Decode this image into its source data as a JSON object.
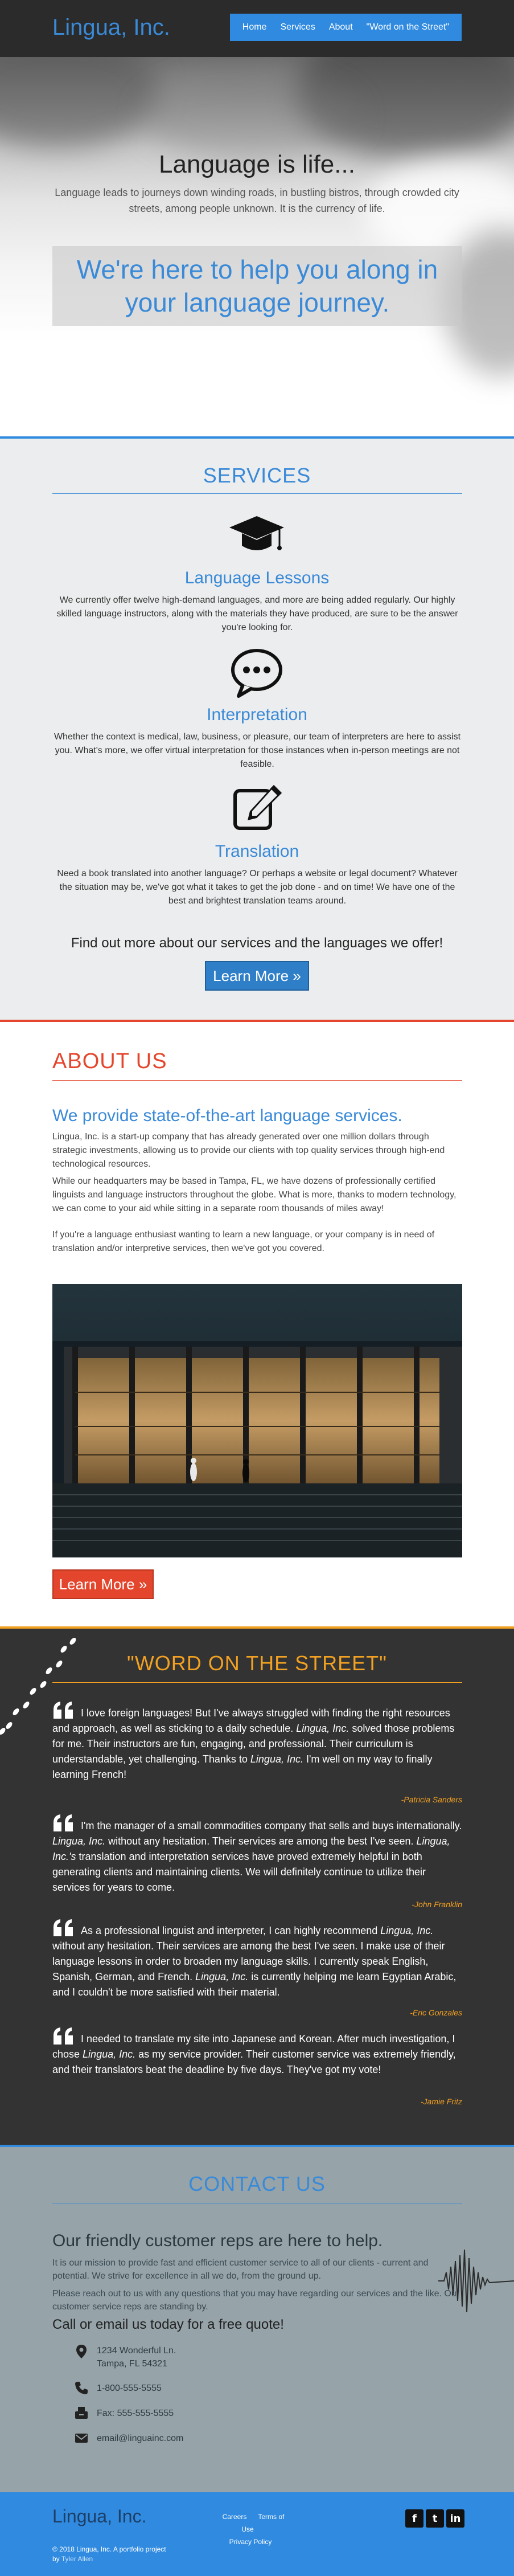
{
  "header": {
    "logo": "Lingua, Inc.",
    "nav": [
      {
        "label": "Home"
      },
      {
        "label": "Services"
      },
      {
        "label": "About"
      },
      {
        "label": "\"Word on the Street\""
      }
    ]
  },
  "hero": {
    "title": "Language is life...",
    "subtitle": "Language leads to journeys down winding roads, in bustling bistros, through crowded city streets, among people unknown. It is the currency of life.",
    "tagline": "We're here to help you along in your language journey."
  },
  "services": {
    "heading": "SERVICES",
    "items": [
      {
        "icon": "graduation-cap-icon",
        "title": "Language Lessons",
        "text": "We currently offer twelve high-demand languages, and more are being added regularly. Our highly skilled language instructors, along with the materials they have produced, are sure to be the answer you're looking for."
      },
      {
        "icon": "speech-bubble-icon",
        "title": "Interpretation",
        "text": "Whether the context is medical, law, business, or pleasure, our team of interpreters are here to assist you. What's more, we offer virtual interpretation for those instances when in-person meetings are not feasible."
      },
      {
        "icon": "edit-icon",
        "title": "Translation",
        "text": "Need a book translated into another language? Or perhaps a website or legal document? Whatever the situation may be, we've got what it takes to get the job done - and on time! We have one of the best and brightest translation teams around."
      }
    ],
    "cta_text": "Find out more about our services and the languages we offer!",
    "cta_button": "Learn More »"
  },
  "about": {
    "heading": "ABOUT US",
    "lead": "We provide state-of-the-art language services.",
    "paragraphs": [
      "Lingua, Inc. is a start-up company that has already generated over one million dollars through strategic investments, allowing us to provide our clients with top quality services through high-end technological resources.",
      "While our headquarters may be based in Tampa, FL, we have dozens of professionally certified linguists and language instructors throughout the globe. What is more, thanks to modern technology, we can come to your aid while sitting in a separate room thousands of miles away!",
      "If you're a language enthusiast wanting to learn a new language, or your company is in need of translation and/or interpretive services, then we've got you covered."
    ],
    "button": "Learn More »"
  },
  "street": {
    "heading": "\"WORD ON THE STREET\"",
    "quotes": [
      {
        "parts": [
          "I love foreign languages! But I've always struggled with finding the right resources and approach, as well as sticking to a daily schedule. ",
          "Lingua, Inc.",
          " solved those problems for me. Their instructors are fun, engaging, and professional. Their curriculum is understandable, yet challenging. Thanks to ",
          "Lingua, Inc.",
          " I'm well on my way to finally learning French!"
        ],
        "author": "-Patricia Sanders"
      },
      {
        "parts": [
          "I'm the manager of a small commodities company that sells and buys internationally. ",
          "Lingua, Inc.",
          " without any hesitation. Their services are among the best I've seen. ",
          "Lingua, Inc.'s",
          " translation and interpretation services have proved extremely helpful in both generating clients and maintaining clients. We will definitely continue to utilize their services for years to come."
        ],
        "author": "-John Franklin"
      },
      {
        "parts": [
          "As a professional linguist and interpreter, I can highly recommend ",
          "Lingua, Inc.",
          " without any hesitation. Their services are among the best I've seen. I make use of their language lessons in order to broaden my language skills. I currently speak English, Spanish, German, and French. ",
          "Lingua, Inc.",
          " is currently helping me learn Egyptian Arabic, and I couldn't be more satisfied with their material."
        ],
        "author": "-Eric Gonzales"
      },
      {
        "parts": [
          "I needed to translate my site into Japanese and Korean. After much investigation, I chose ",
          "Lingua, Inc.",
          " as my service provider. Their customer service was extremely friendly, and their translators beat the deadline by five days. They've got my vote!"
        ],
        "author": "-Jamie Fritz"
      }
    ]
  },
  "contact": {
    "heading": "CONTACT US",
    "lead": "Our friendly customer reps are here to help.",
    "paragraphs": [
      "It is our mission to provide fast and efficient customer service to all of our clients - current and potential. We strive for excellence in all we do, from the ground up.",
      "Please reach out to us with any questions that you may have regarding our services and the like. Our customer service reps are standing by."
    ],
    "call_text": "Call or email us today for a free quote!",
    "address_line1": "1234 Wonderful Ln.",
    "address_line2": "Tampa, FL 54321",
    "phone": "1-800-555-5555",
    "fax": "Fax: 555-555-5555",
    "email": "email@linguainc.com"
  },
  "footer": {
    "logo": "Lingua, Inc.",
    "copyright": "© 2018 Lingua, Inc.  A portfolio project",
    "credit_by": "by",
    "credit_name": "Tyler Allen",
    "links": [
      "Careers",
      "Terms of Use",
      "Privacy Policy"
    ],
    "socials": [
      {
        "icon": "facebook-icon",
        "glyph": "f"
      },
      {
        "icon": "twitter-icon",
        "glyph": "t"
      },
      {
        "icon": "linkedin-icon",
        "glyph": "in"
      }
    ]
  },
  "colors": {
    "brand_blue": "#3a8ad8",
    "accent_red": "#e4462d",
    "accent_orange": "#f2a122",
    "dark": "#333333"
  }
}
